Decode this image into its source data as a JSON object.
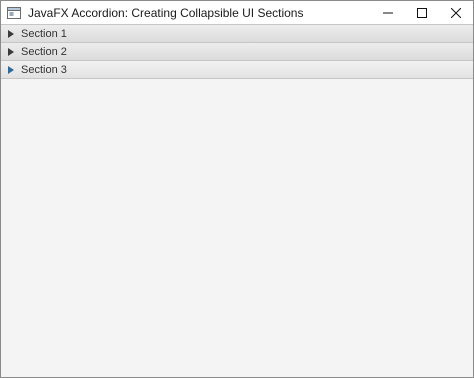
{
  "window": {
    "title": "JavaFX Accordion: Creating Collapsible UI Sections",
    "icon": "java-app-icon",
    "controls": [
      "minimize-icon",
      "maximize-icon",
      "close-icon"
    ]
  },
  "accordion": {
    "panes": [
      {
        "label": "Section 1",
        "expanded": false,
        "hovered": false
      },
      {
        "label": "Section 2",
        "expanded": false,
        "hovered": false
      },
      {
        "label": "Section 3",
        "expanded": false,
        "hovered": true
      }
    ]
  },
  "colors": {
    "arrow": "#3a3a3a",
    "arrow_hover": "#2d6b9e",
    "content_bg": "#f4f4f4"
  }
}
